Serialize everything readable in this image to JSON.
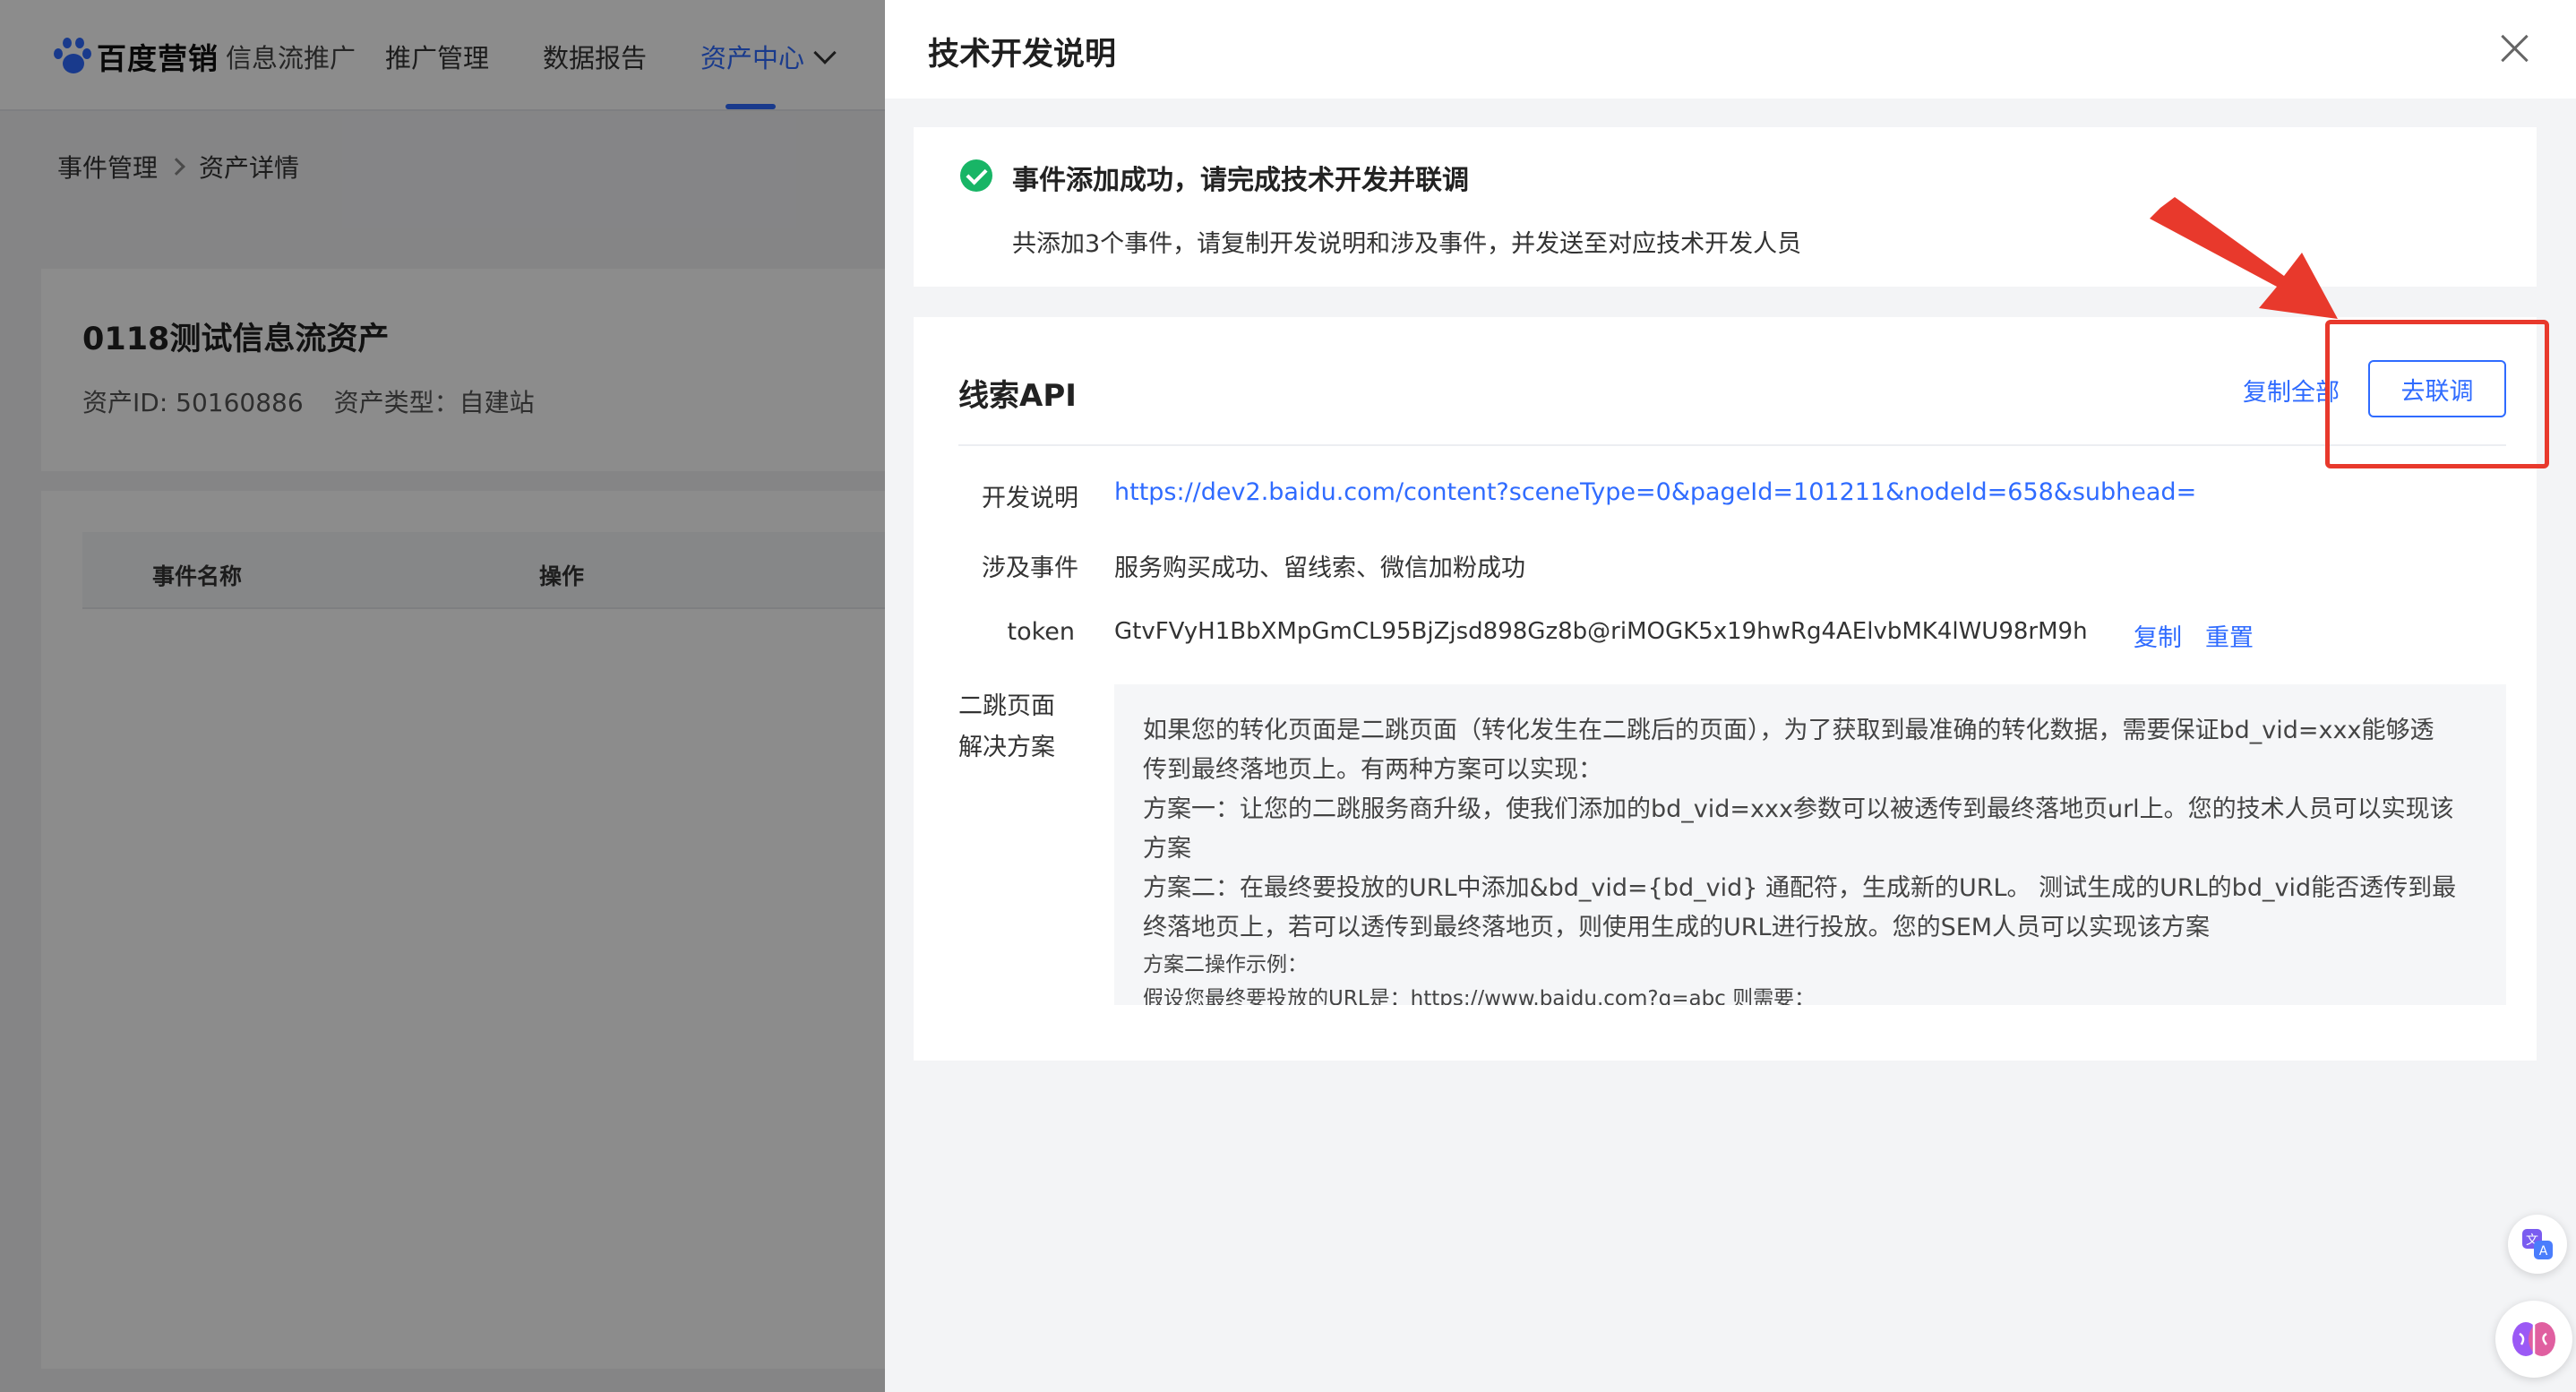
{
  "nav": {
    "logo_text": "百度营销",
    "logo_sub": "信息流推广",
    "items": [
      "推广管理",
      "数据报告",
      "资产中心"
    ],
    "active_index": 2
  },
  "breadcrumb": [
    "事件管理",
    "资产详情"
  ],
  "asset": {
    "title": "0118测试信息流资产",
    "id_text": "资产ID: 50160886",
    "type_text": "资产类型：自建站"
  },
  "table": {
    "headers": [
      "事件名称",
      "操作"
    ]
  },
  "drawer": {
    "title": "技术开发说明",
    "success_title": "事件添加成功，请完成技术开发并联调",
    "success_desc": "共添加3个事件，请复制开发说明和涉及事件，并发送至对应技术开发人员",
    "api_title": "线索API",
    "copy_all": "复制全部",
    "goto_debug": "去联调",
    "dev_doc_label": "开发说明",
    "dev_doc_link": "https://dev2.baidu.com/content?sceneType=0&pageId=101211&nodeId=658&subhead=",
    "events_label": "涉及事件",
    "events_value": "服务购买成功、留线索、微信加粉成功",
    "token_label": "token",
    "token_value": "GtvFVyH1BbXMpGmCL95BjZjsd898Gz8b@riMOGK5x19hwRg4AElvbMK4lWU98rM9h",
    "token_copy": "复制",
    "token_reset": "重置",
    "solution_label_1": "二跳页面",
    "solution_label_2": "解决方案",
    "solution_lines": [
      "如果您的转化页面是二跳页面（转化发生在二跳后的页面），为了获取到最准确的转化数据，需要保证bd_vid=xxx能够透",
      "传到最终落地页上。有两种方案可以实现：",
      "方案一：让您的二跳服务商升级，使我们添加的bd_vid=xxx参数可以被透传到最终落地页url上。您的技术人员可以实现该",
      "方案",
      "方案二：在最终要投放的URL中添加&bd_vid={bd_vid} 通配符，生成新的URL。 测试生成的URL的bd_vid能否透传到最",
      "终落地页上，若可以透传到最终落地页，则使用生成的URL进行投放。您的SEM人员可以实现该方案"
    ],
    "solution_small_lines": [
      "方案二操作示例：",
      "假设您最终要投放的URL是：https://www.baidu.com?q=abc 则需要："
    ]
  },
  "colors": {
    "primary": "#2f6bff",
    "success": "#18b566",
    "annotation": "#e8392c"
  },
  "icons": {
    "close": "close-icon",
    "success": "check-circle-icon",
    "translate": "translate-icon",
    "assistant": "brain-icon"
  }
}
